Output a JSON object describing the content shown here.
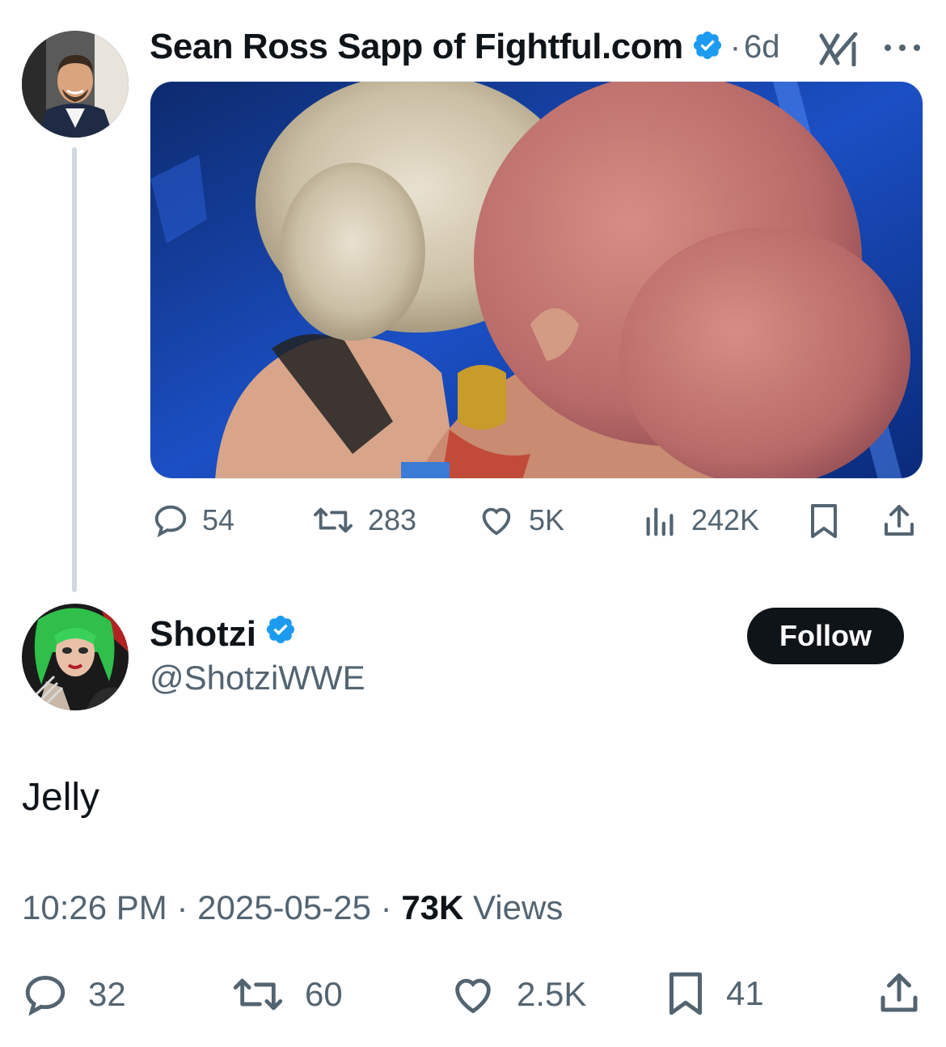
{
  "parent_tweet": {
    "author_name": "Sean Ross Sapp of Fightful.com",
    "time_ago": "6d",
    "separator": "·",
    "stats": {
      "replies": "54",
      "reposts": "283",
      "likes": "5K",
      "views": "242K"
    }
  },
  "reply_tweet": {
    "author_name": "Shotzi",
    "handle": "@ShotziWWE",
    "follow_label": "Follow",
    "text": "Jelly",
    "time": "10:26 PM",
    "date": "2025-05-25",
    "views_count": "73K",
    "views_label": "Views",
    "separator": "·",
    "stats": {
      "replies": "32",
      "reposts": "60",
      "likes": "2.5K",
      "bookmarks": "41"
    }
  },
  "colors": {
    "verified_blue": "#1d9bf0",
    "text_primary": "#0f1419",
    "text_secondary": "#536471",
    "thread_line": "#cfd9de"
  }
}
